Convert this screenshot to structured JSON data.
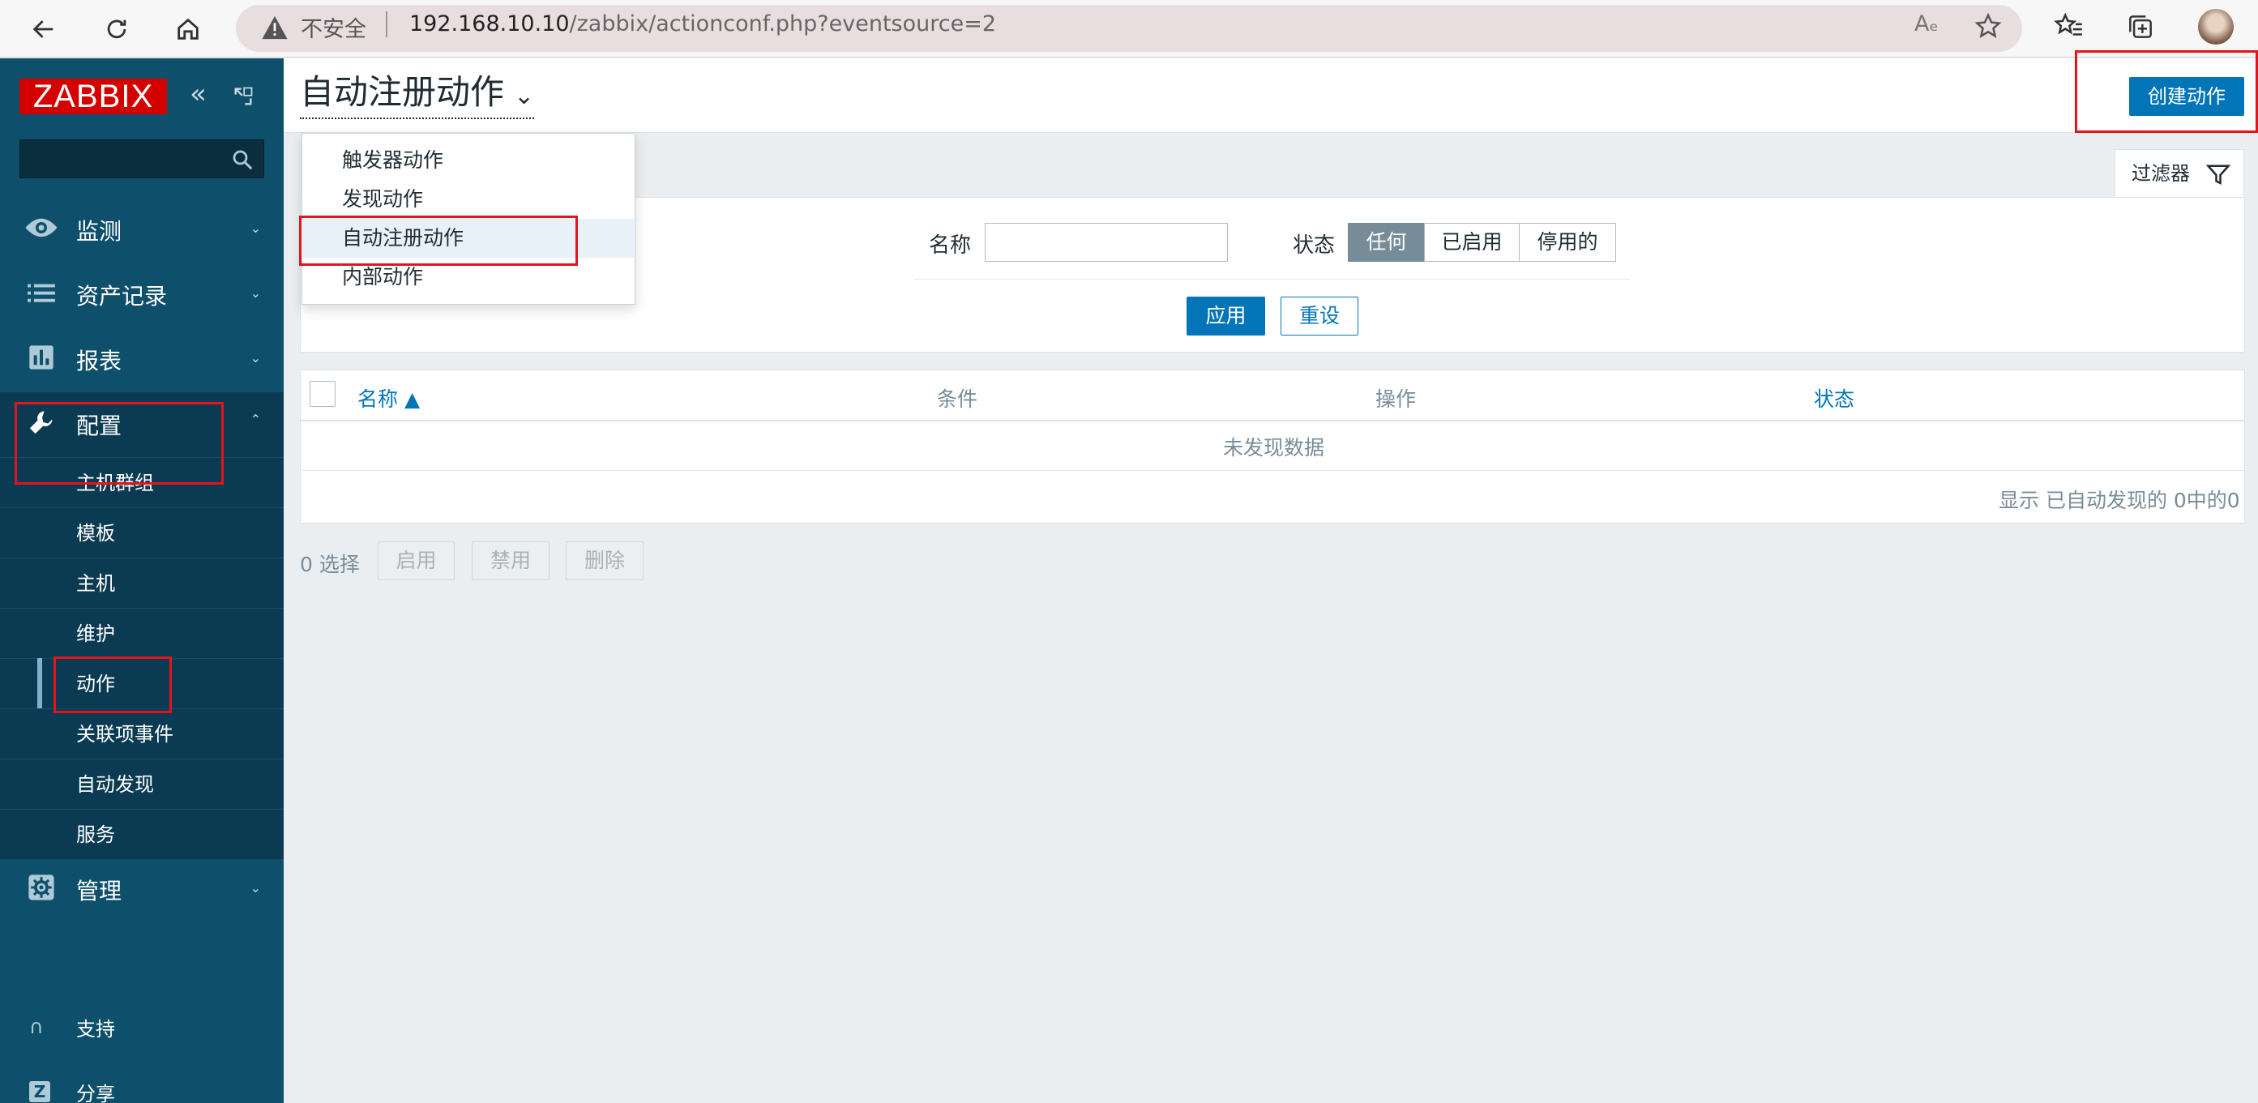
{
  "browser": {
    "security_label": "不安全",
    "url_host": "192.168.10.10",
    "url_path": "/zabbix/actionconf.php?eventsource=2",
    "read_aloud_label": "Aₑ"
  },
  "sidebar": {
    "logo": "ZABBIX",
    "search_placeholder": "",
    "menu": [
      {
        "label": "监测",
        "icon": "eye-icon"
      },
      {
        "label": "资产记录",
        "icon": "list-icon"
      },
      {
        "label": "报表",
        "icon": "bar-chart-icon"
      },
      {
        "label": "配置",
        "icon": "wrench-icon"
      },
      {
        "label": "管理",
        "icon": "gear-icon"
      }
    ],
    "config_sub": [
      "主机群组",
      "模板",
      "主机",
      "维护",
      "动作",
      "关联项事件",
      "自动发现",
      "服务"
    ],
    "footer": [
      {
        "label": "支持",
        "icon": "headset-icon"
      },
      {
        "label": "分享",
        "icon": "share-z-icon"
      }
    ]
  },
  "header": {
    "title": "自动注册动作",
    "create_button": "创建动作"
  },
  "dropdown": {
    "items": [
      "触发器动作",
      "发现动作",
      "自动注册动作",
      "内部动作"
    ]
  },
  "filter": {
    "tab_label": "过滤器",
    "name_label": "名称",
    "name_value": "",
    "status_label": "状态",
    "status_options": [
      "任何",
      "已启用",
      "停用的"
    ],
    "status_selected": "任何",
    "apply": "应用",
    "reset": "重设"
  },
  "table": {
    "columns": [
      "名称 ▲",
      "条件",
      "操作",
      "状态"
    ],
    "no_data": "未发现数据",
    "paging": "显示 已自动发现的 0中的0"
  },
  "actions": {
    "selected": "0 选择",
    "enable": "启用",
    "disable": "禁用",
    "delete": "删除"
  }
}
